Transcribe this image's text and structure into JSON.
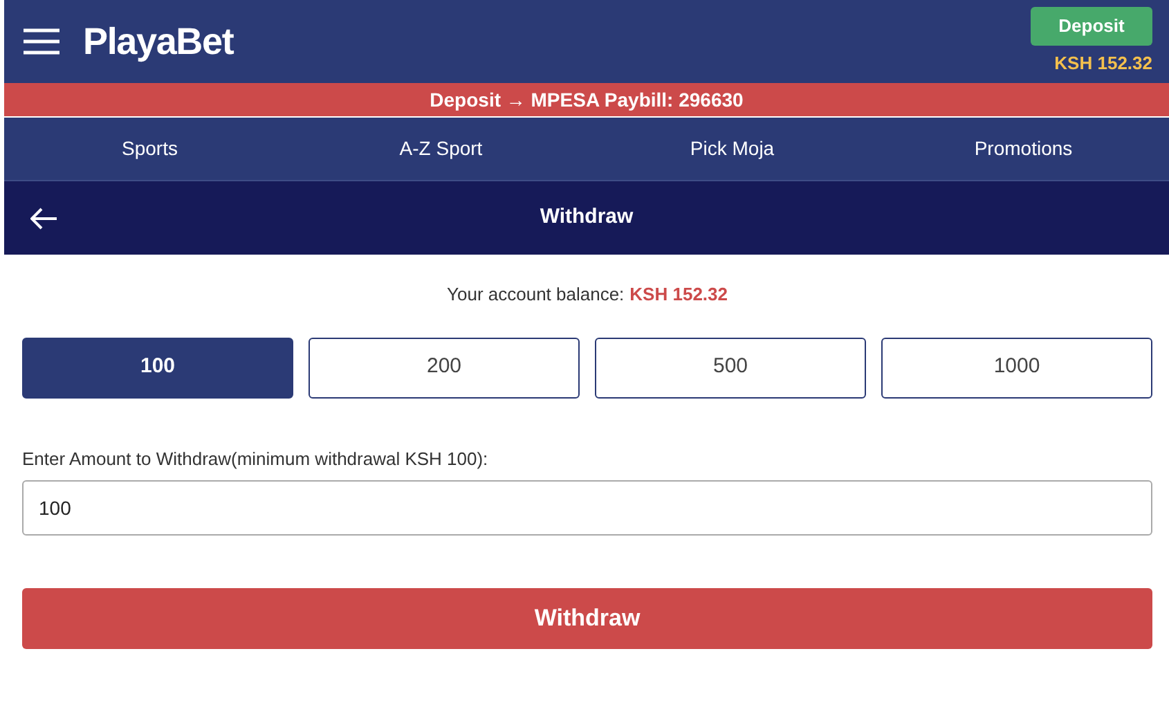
{
  "header": {
    "logo": "PlayaBet",
    "deposit_button": "Deposit",
    "balance": "KSH 152.32"
  },
  "banner": "Deposit → MPESA Paybill: 296630",
  "nav": [
    {
      "label": "Sports"
    },
    {
      "label": "A-Z Sport"
    },
    {
      "label": "Pick Moja"
    },
    {
      "label": "Promotions"
    }
  ],
  "page_title": "Withdraw",
  "balance_line": {
    "label": "Your account balance:",
    "amount": "KSH 152.32"
  },
  "amounts": [
    {
      "label": "100",
      "selected": true
    },
    {
      "label": "200",
      "selected": false
    },
    {
      "label": "500",
      "selected": false
    },
    {
      "label": "1000",
      "selected": false
    }
  ],
  "amount_field": {
    "label": "Enter Amount to Withdraw(minimum withdrawal KSH 100):",
    "value": "100"
  },
  "submit_button": "Withdraw"
}
